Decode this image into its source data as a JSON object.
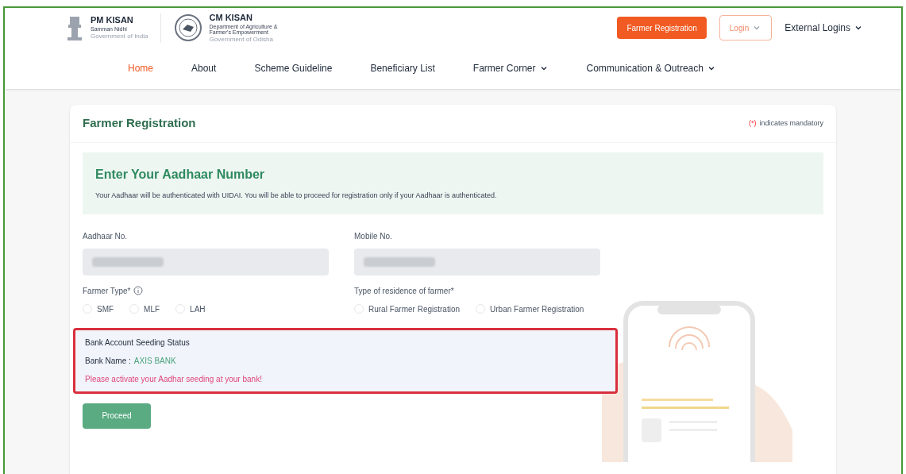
{
  "header": {
    "logos": [
      {
        "kind": "emblem",
        "title": "PM KISAN",
        "subtitle": "Samman Nidhi",
        "caption": "Government of India"
      },
      {
        "kind": "seal",
        "title": "CM KISAN",
        "subtitle": "Department of Agriculture & Farmer's Empowerment",
        "caption": "Government of Odisha"
      }
    ],
    "buttons": [
      {
        "kind": "primary",
        "label": "Farmer Registration"
      },
      {
        "kind": "outline",
        "label": "Login"
      },
      {
        "kind": "plain",
        "label": "External Logins"
      }
    ]
  },
  "nav": [
    {
      "label": "Home",
      "selected": true,
      "dropdown": false
    },
    {
      "label": "About",
      "selected": false,
      "dropdown": false
    },
    {
      "label": "Scheme Guideline",
      "selected": false,
      "dropdown": false
    },
    {
      "label": "Beneficiary List",
      "selected": false,
      "dropdown": false
    },
    {
      "label": "Farmer Corner",
      "selected": false,
      "dropdown": true
    },
    {
      "label": "Communication & Outreach",
      "selected": false,
      "dropdown": true
    }
  ],
  "card": {
    "title": "Farmer Registration",
    "mandatory_mark": "(*)",
    "mandatory_note": "indicates mandatory",
    "intro": {
      "heading": "Enter Your Aadhaar Number",
      "text": "Your Aadhaar will be authenticated with UIDAI. You will be able to proceed for registration only if your Aadhaar is authenticated."
    },
    "fields": [
      {
        "label": "Aadhaar No."
      },
      {
        "label": "Mobile No."
      }
    ],
    "radio_groups": [
      {
        "label": "Farmer Type*",
        "info": true,
        "options": [
          {
            "label": "SMF",
            "selected": false
          },
          {
            "label": "MLF",
            "selected": false
          },
          {
            "label": "LAH",
            "selected": false
          }
        ]
      },
      {
        "label": "Type of residence of farmer*",
        "info": false,
        "options": [
          {
            "label": "Rural Farmer Registration",
            "selected": false
          },
          {
            "label": "Urban Farmer Registration",
            "selected": false
          }
        ]
      }
    ],
    "bank_status": {
      "title": "Bank Account Seeding Status",
      "bank_label": "Bank Name :",
      "bank_value": "AXIS BANK",
      "warning": "Please activate your Aadhar seeding at your bank!"
    },
    "proceed": "Proceed"
  }
}
